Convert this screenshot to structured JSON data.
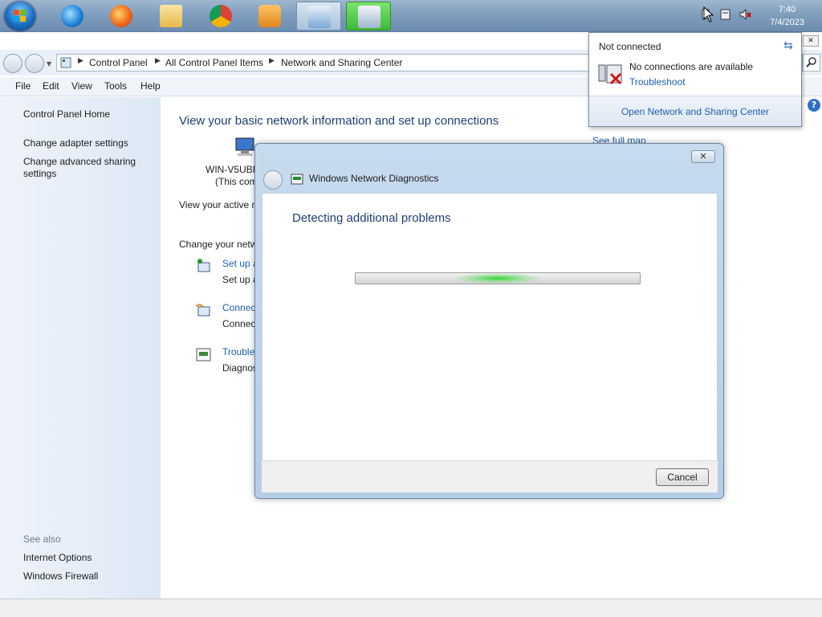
{
  "taskbar": {
    "clock_time": "7:40",
    "clock_date": "7/4/2023",
    "pinned": [
      "start-orb",
      "internet-explorer-icon",
      "firefox-icon",
      "file-explorer-icon",
      "chrome-icon",
      "media-player-icon",
      "control-panel-icon",
      "network-diagnostics-icon"
    ]
  },
  "address_bar": {
    "crumbs": [
      "Control Panel",
      "All Control Panel Items",
      "Network and Sharing Center"
    ]
  },
  "menu": {
    "file": "File",
    "edit": "Edit",
    "view": "View",
    "tools": "Tools",
    "help": "Help"
  },
  "left_pane": {
    "home": "Control Panel Home",
    "adapter": "Change adapter settings",
    "sharing": "Change advanced sharing settings",
    "see_also": "See also",
    "internet_options": "Internet Options",
    "firewall": "Windows Firewall"
  },
  "main": {
    "title": "View your basic network information and set up connections",
    "pc_name": "WIN-V5UBF",
    "pc_sub": "(This com",
    "see_full_map": "See full map",
    "view_active": "View your active n",
    "change_network": "Change your netw",
    "tasks": [
      {
        "link": "Set up a",
        "desc": "Set up a"
      },
      {
        "link": "Connec",
        "desc": "Connec"
      },
      {
        "link": "Trouble",
        "desc": "Diagnos"
      }
    ]
  },
  "dialog": {
    "title": "Windows Network Diagnostics",
    "heading": "Detecting additional problems",
    "cancel": "Cancel",
    "close": "✕"
  },
  "flyout": {
    "header": "Not connected",
    "message": "No connections are available",
    "troubleshoot": "Troubleshoot",
    "open_center": "Open Network and Sharing Center"
  },
  "colors": {
    "link": "#1f5fa8",
    "heading": "#1e3f73",
    "progress_glow": "#36d636"
  }
}
